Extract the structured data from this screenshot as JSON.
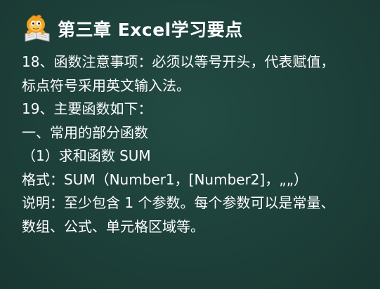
{
  "slide": {
    "title": "第三章 Excel学习要点",
    "logo_icon": "cartoon-mascot-book-icon",
    "lines": [
      "18、函数注意事项：必须以等号开头，代表赋值，",
      "标点符号采用英文输入法。",
      "19、主要函数如下：",
      "一、常用的部分函数",
      "（1）求和函数 SUM",
      "格式：SUM（Number1，[Number2]，„„）",
      "说明：至少包含 1 个参数。每个参数可以是常量、",
      "数组、公式、单元格区域等。"
    ]
  },
  "colors": {
    "background": "#1d3f39",
    "text": "#ffffff",
    "logo_orange": "#f0a020",
    "logo_book": "#e8e8e8"
  }
}
